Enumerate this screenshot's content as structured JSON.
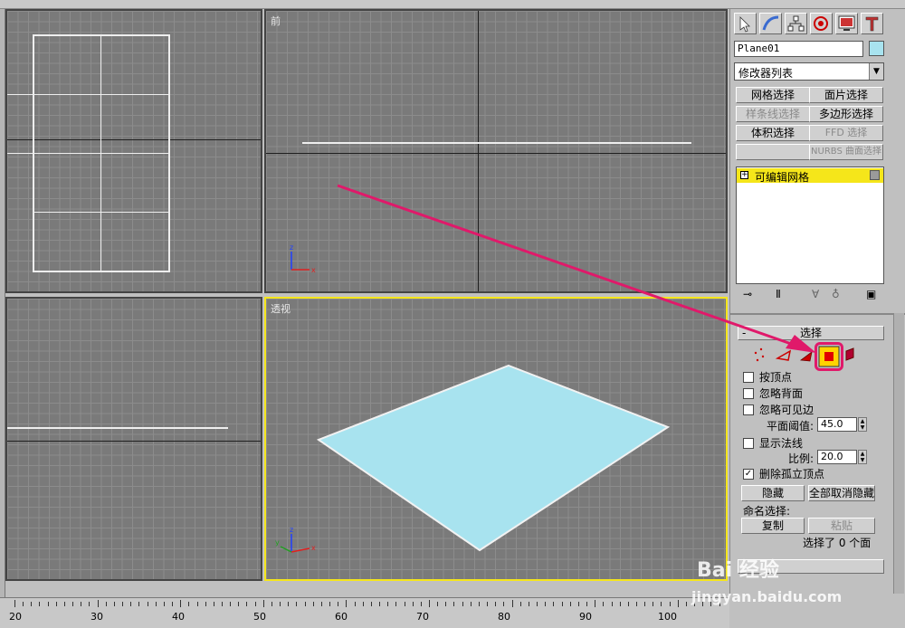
{
  "viewports": {
    "front_label": "前",
    "perspective_label": "透视"
  },
  "panel": {
    "object_name": "Plane01",
    "modifier_list": "修改器列表",
    "buttons": {
      "mesh_select": "网格选择",
      "patch_select": "面片选择",
      "spline_select": "样条线选择",
      "poly_select": "多边形选择",
      "volume_select": "体积选择",
      "ffd_select": "FFD 选择",
      "nurbs_select": "NURBS 曲面选择"
    },
    "stack_item": "可编辑网格",
    "rollout_title": "选择",
    "checks": {
      "by_vertex": "按顶点",
      "ignore_backface": "忽略背面",
      "ignore_visible_edges": "忽略可见边",
      "show_normals": "显示法线",
      "delete_isolated": "删除孤立顶点"
    },
    "planar_threshold_label": "平面阈值:",
    "planar_threshold_value": "45.0",
    "scale_label": "比例:",
    "scale_value": "20.0",
    "hide": "隐藏",
    "unhide_all": "全部取消隐藏",
    "named_selection": "命名选择:",
    "copy": "复制",
    "paste": "粘贴",
    "status": "选择了 0 个面"
  },
  "ruler": {
    "ticks": [
      "20",
      "30",
      "40",
      "50",
      "60",
      "70",
      "80",
      "90",
      "100"
    ]
  },
  "watermark": {
    "brand": "Bai 经验",
    "url": "jingyan.baidu.com"
  },
  "colors": {
    "plane": "#a8e3ef",
    "active_border": "#f5e61a",
    "arrow": "#e0196a"
  }
}
